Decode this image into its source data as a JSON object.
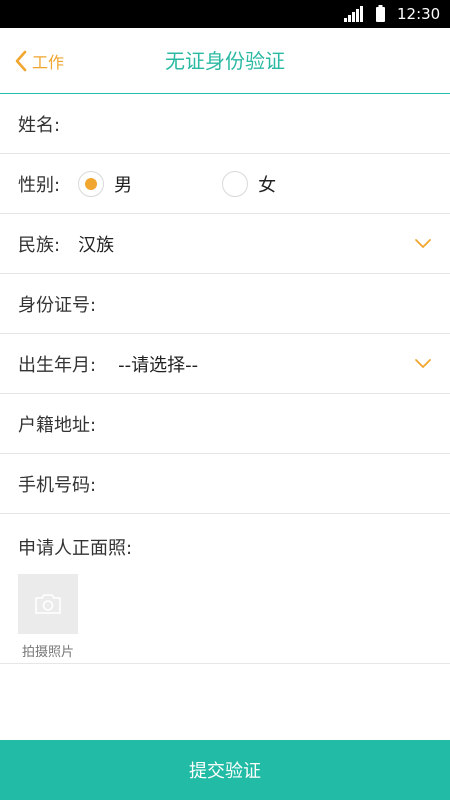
{
  "status_bar": {
    "time": "12:30"
  },
  "nav": {
    "back_label": "工作",
    "title": "无证身份验证"
  },
  "form": {
    "name_label": "姓名:",
    "gender_label": "性别:",
    "gender_options": [
      "男",
      "女"
    ],
    "gender_selected": "男",
    "ethnicity_label": "民族:",
    "ethnicity_value": "汉族",
    "id_number_label": "身份证号:",
    "birth_label": "出生年月:",
    "birth_value": "--请选择--",
    "address_label": "户籍地址:",
    "phone_label": "手机号码:",
    "photo_label": "申请人正面照:",
    "photo_caption": "拍摄照片"
  },
  "submit_label": "提交验证",
  "colors": {
    "accent": "#22bba5",
    "highlight": "#f0a62f"
  }
}
